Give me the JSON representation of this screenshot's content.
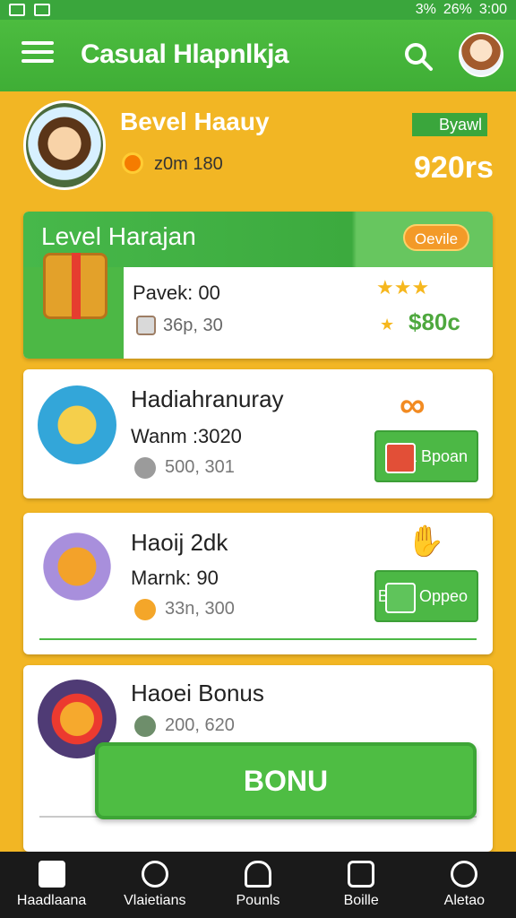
{
  "status_bar": {
    "battery": "26%",
    "time": "3:00",
    "signal_text": "3%"
  },
  "app_bar": {
    "title": "Casual Hlapnlkja"
  },
  "profile": {
    "name": "Bevel Haauy",
    "score_line": "z0m 180",
    "badge": "Byawl",
    "points": "920rs"
  },
  "level_card": {
    "title": "Level Harajan",
    "pill": "Oevile",
    "label": "Pavek: 00",
    "sub": "36p, 30",
    "stars": "★★★",
    "amount": "$80c"
  },
  "cards": [
    {
      "title": "Hadiahranuray",
      "sub": "Wanm :3020",
      "small": "500, 301",
      "button": "Biva Bpoan"
    },
    {
      "title": "Haoij 2dk",
      "sub": "Marnk: 90",
      "small": "33n, 300",
      "button": "Baya Oppeo"
    },
    {
      "title": "Haoei Bonus",
      "small": "200, 620"
    }
  ],
  "bonus_button": "BONU",
  "bottom_nav": [
    {
      "label": "Haadlaana",
      "icon": "home-icon"
    },
    {
      "label": "Vlaietians",
      "icon": "search-icon"
    },
    {
      "label": "Pounls",
      "icon": "shield-icon"
    },
    {
      "label": "Boille",
      "icon": "book-icon"
    },
    {
      "label": "Aletao",
      "icon": "coins-icon"
    }
  ],
  "colors": {
    "primary_green": "#4cb845",
    "background": "#f2b624",
    "accent_orange": "#f39a28"
  }
}
